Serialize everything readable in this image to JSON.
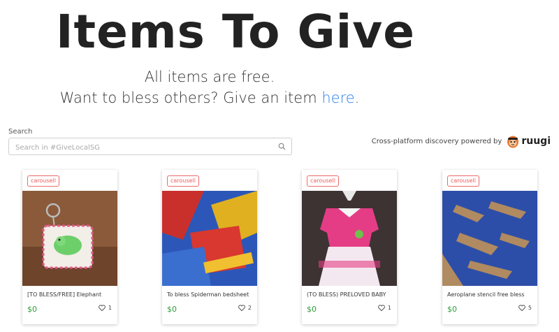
{
  "header": {
    "title": "Items To Give",
    "line1": "All items are free.",
    "line2_prefix": "Want to bless others? Give an item ",
    "line2_link": "here",
    "line2_suffix": "."
  },
  "search": {
    "label": "Search",
    "placeholder": "Search in #GiveLocalSG",
    "value": ""
  },
  "powered": {
    "text": "Cross-platform discovery powered by",
    "brand": "ruugi"
  },
  "items": [
    {
      "badge": "carousell",
      "title": "[TO BLESS/FREE] Elephant",
      "price": "$0",
      "likes": "1"
    },
    {
      "badge": "carousell",
      "title": "To bless Spiderman bedsheet",
      "price": "$0",
      "likes": "2"
    },
    {
      "badge": "carousell",
      "title": "(TO BLESS) PRELOVED BABY",
      "price": "$0",
      "likes": "1"
    },
    {
      "badge": "carousell",
      "title": "Aeroplane stencil free bless",
      "price": "$0",
      "likes": "5"
    }
  ],
  "colors": {
    "link": "#2f80ed",
    "price": "#2e9d3a",
    "badge": "#ee5a5a"
  }
}
